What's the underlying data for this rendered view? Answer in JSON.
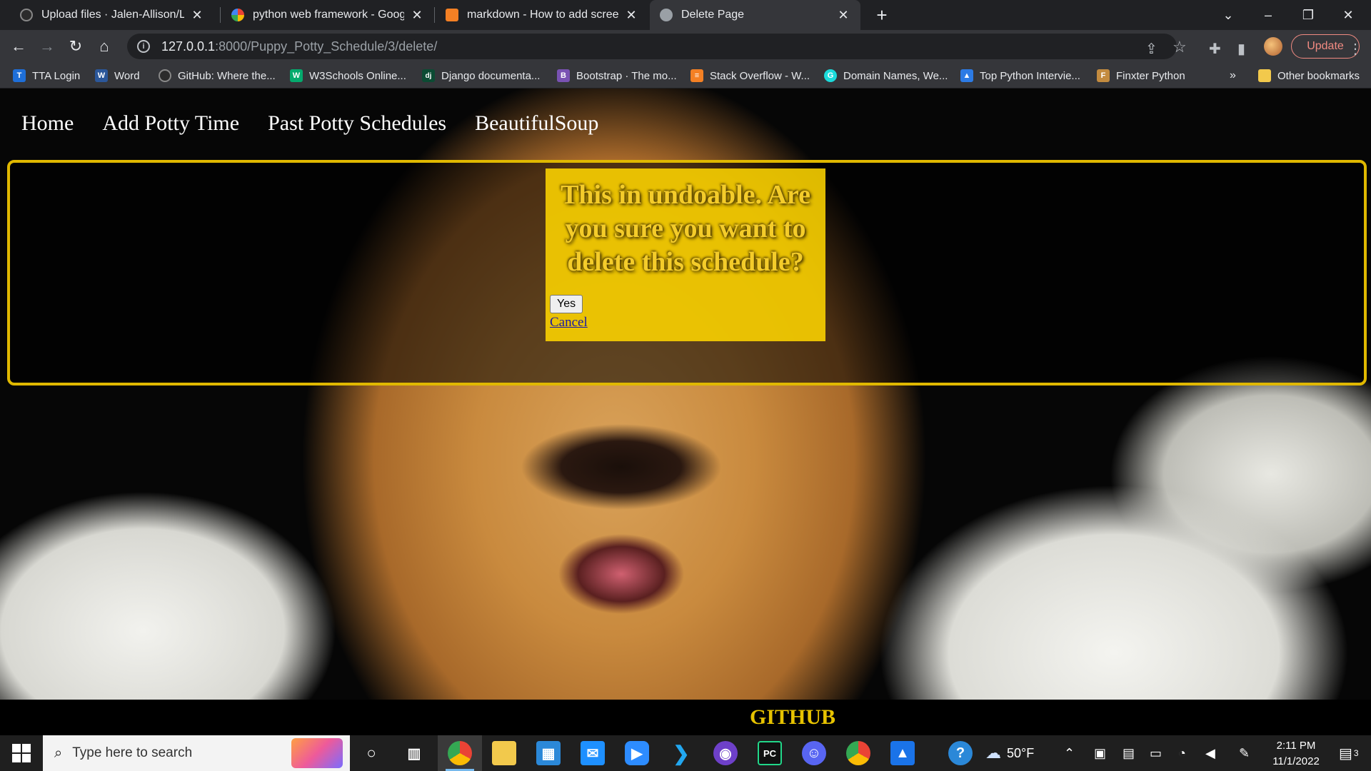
{
  "browser": {
    "tabs": [
      {
        "title": "Upload files · Jalen-Allison/Live-P",
        "icon": "github-icon",
        "color": "#2b2b2b"
      },
      {
        "title": "python web framework - Google",
        "icon": "google-icon",
        "color": "#ffffff"
      },
      {
        "title": "markdown - How to add screensh",
        "icon": "stackoverflow-icon",
        "color": "#f48024"
      },
      {
        "title": "Delete Page",
        "icon": "globe-icon",
        "color": "#9aa0a6"
      }
    ],
    "address": {
      "host": "127.0.0.1",
      "path": ":8000/Puppy_Potty_Schedule/3/delete/"
    },
    "update_label": "Update",
    "bookmarks": [
      {
        "label": "TTA Login",
        "color": "#1e6fd9",
        "glyph": "T"
      },
      {
        "label": "Word",
        "color": "#2b579a",
        "glyph": "W"
      },
      {
        "label": "GitHub: Where the...",
        "color": "#2b2b2b",
        "glyph": "●"
      },
      {
        "label": "W3Schools Online...",
        "color": "#04aa6d",
        "glyph": "W"
      },
      {
        "label": "Django documenta...",
        "color": "#0c4b33",
        "glyph": "dj"
      },
      {
        "label": "Bootstrap · The mo...",
        "color": "#7952b3",
        "glyph": "B"
      },
      {
        "label": "Stack Overflow - W...",
        "color": "#f48024",
        "glyph": "≡"
      },
      {
        "label": "Domain Names, We...",
        "color": "#1bdbdb",
        "glyph": "G"
      },
      {
        "label": "Top Python Intervie...",
        "color": "#2c7be5",
        "glyph": "▲"
      },
      {
        "label": "Finxter Python",
        "color": "#c38b3f",
        "glyph": "F"
      }
    ],
    "bookmarks_overflow": "»",
    "other_bookmarks": "Other bookmarks"
  },
  "page": {
    "nav": [
      "Home",
      "Add Potty Time",
      "Past Potty Schedules",
      "BeautifulSoup"
    ],
    "confirm_message": "This in undoable. Are you sure you want to delete this schedule?",
    "yes_label": "Yes",
    "cancel_label": "Cancel",
    "footer_link": "GITHUB",
    "colors": {
      "accent": "#e0b800",
      "box": "#ffd600"
    }
  },
  "taskbar": {
    "search_placeholder": "Type here to search",
    "weather": "50°F",
    "time": "2:11 PM",
    "date": "11/1/2022",
    "notifications": "3"
  }
}
